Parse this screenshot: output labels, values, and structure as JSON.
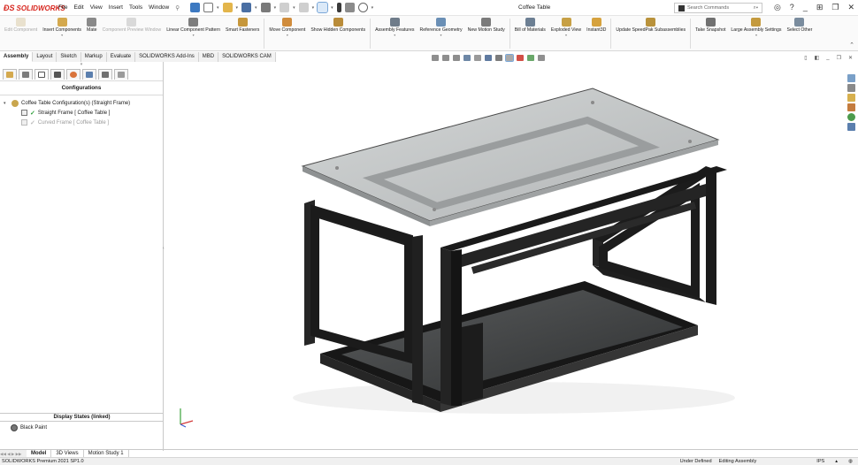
{
  "app": {
    "logo": "SOLIDWORKS",
    "document_title": "Coffee Table"
  },
  "menu": [
    "File",
    "Edit",
    "View",
    "Insert",
    "Tools",
    "Window"
  ],
  "search": {
    "placeholder": "Search Commands"
  },
  "ribbon": [
    {
      "label": "Edit Component",
      "icon": "edit-component-icon",
      "enabled": false,
      "color": "#c9b27a"
    },
    {
      "label": "Insert Components",
      "icon": "insert-components-icon",
      "enabled": true,
      "color": "#d4a94e",
      "dropdown": true
    },
    {
      "label": "Mate",
      "icon": "mate-icon",
      "enabled": true,
      "color": "#8a8a8a"
    },
    {
      "label": "Component Preview Window",
      "icon": "preview-window-icon",
      "enabled": false,
      "color": "#9a9a9a"
    },
    {
      "label": "Linear Component Pattern",
      "icon": "linear-pattern-icon",
      "enabled": true,
      "color": "#7d7d7d",
      "dropdown": true
    },
    {
      "label": "Smart Fasteners",
      "icon": "smart-fasteners-icon",
      "enabled": true,
      "color": "#c6973b"
    },
    {
      "label": "Move Component",
      "icon": "move-component-icon",
      "enabled": true,
      "color": "#d08c3c",
      "dropdown": true
    },
    {
      "label": "Show Hidden Components",
      "icon": "show-hidden-icon",
      "enabled": true,
      "color": "#b98c3a"
    },
    {
      "label": "Assembly Features",
      "icon": "assembly-features-icon",
      "enabled": true,
      "color": "#6f7c8a",
      "dropdown": true
    },
    {
      "label": "Reference Geometry",
      "icon": "reference-geometry-icon",
      "enabled": true,
      "color": "#6a8fb5",
      "dropdown": true
    },
    {
      "label": "New Motion Study",
      "icon": "motion-study-icon",
      "enabled": true,
      "color": "#7b7b7b"
    },
    {
      "label": "Bill of Materials",
      "icon": "bill-of-materials-icon",
      "enabled": true,
      "color": "#6c7f93"
    },
    {
      "label": "Exploded View",
      "icon": "exploded-view-icon",
      "enabled": true,
      "color": "#c7a045",
      "dropdown": true
    },
    {
      "label": "Instant3D",
      "icon": "instant3d-icon",
      "enabled": true,
      "color": "#d6a23e"
    },
    {
      "label": "Update SpeedPak Subassemblies",
      "icon": "speedpak-icon",
      "enabled": true,
      "color": "#b9923b"
    },
    {
      "label": "Take Snapshot",
      "icon": "snapshot-icon",
      "enabled": true,
      "color": "#707070"
    },
    {
      "label": "Large Assembly Settings",
      "icon": "large-assembly-icon",
      "enabled": true,
      "color": "#c49a3e",
      "dropdown": true
    },
    {
      "label": "Select Other",
      "icon": "select-other-icon",
      "enabled": true,
      "color": "#7a8c9e"
    }
  ],
  "tabs": [
    "Assembly",
    "Layout",
    "Sketch",
    "Markup",
    "Evaluate",
    "SOLIDWORKS Add-Ins",
    "MBD",
    "SOLIDWORKS CAM"
  ],
  "active_tab": "Assembly",
  "left_panel": {
    "header": "Configurations",
    "tree": [
      {
        "label": "Coffee Table Configuration(s)  (Straight Frame)",
        "level": 0,
        "icon": "assembly-icon"
      },
      {
        "label": "Straight Frame [ Coffee Table ]",
        "level": 1,
        "active": true,
        "icon": "configuration-icon"
      },
      {
        "label": "Curved Frame [ Coffee Table ]",
        "level": 1,
        "active": false,
        "icon": "configuration-icon"
      }
    ],
    "display_states_header": "Display States (linked)",
    "display_states": [
      "Black Paint"
    ]
  },
  "bottom_tabs": [
    "Model",
    "3D Views",
    "Motion Study 1"
  ],
  "active_bottom_tab": "Model",
  "status": {
    "product": "SOLIDWORKS Premium 2021 SP1.0",
    "definition": "Under Defined",
    "mode": "Editing Assembly",
    "units": "IPS"
  },
  "colors": {
    "brand": "#d7261e",
    "frame": "#1d1d1d",
    "glass": "#b8bcbd"
  }
}
